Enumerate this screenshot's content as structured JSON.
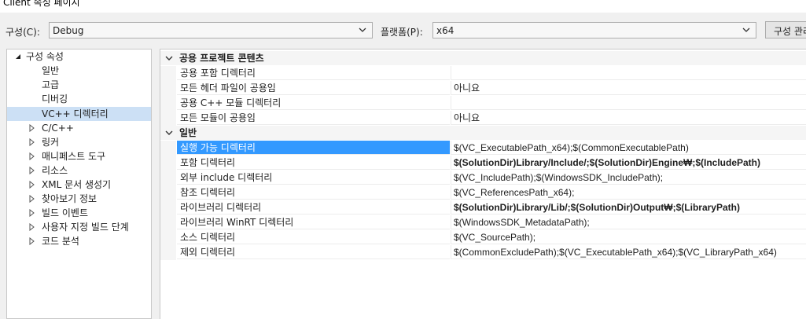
{
  "window": {
    "title": "Client 속성 페이지"
  },
  "toolbar": {
    "config_label": "구성(C):",
    "config_value": "Debug",
    "platform_label": "플랫폼(P):",
    "platform_value": "x64",
    "config_manager_label": "구성 관리자"
  },
  "tree": {
    "root": "구성 속성",
    "items": [
      {
        "label": "일반"
      },
      {
        "label": "고급"
      },
      {
        "label": "디버깅"
      },
      {
        "label": "VC++ 디렉터리"
      },
      {
        "label": "C/C++"
      },
      {
        "label": "링커"
      },
      {
        "label": "매니페스트 도구"
      },
      {
        "label": "리소스"
      },
      {
        "label": "XML 문서 생성기"
      },
      {
        "label": "찾아보기 정보"
      },
      {
        "label": "빌드 이벤트"
      },
      {
        "label": "사용자 지정 빌드 단계"
      },
      {
        "label": "코드 분석"
      }
    ]
  },
  "grid": {
    "categories": [
      {
        "title": "공용 프로젝트 콘텐츠",
        "rows": [
          {
            "name": "공용 포함 디렉터리",
            "value": ""
          },
          {
            "name": "모든 헤더 파일이 공용임",
            "value": "아니요"
          },
          {
            "name": "공용 C++ 모듈 디렉터리",
            "value": ""
          },
          {
            "name": "모든 모듈이 공용임",
            "value": "아니요"
          }
        ]
      },
      {
        "title": "일반",
        "rows": [
          {
            "name": "실행 가능 디렉터리",
            "value": "$(VC_ExecutablePath_x64);$(CommonExecutablePath)"
          },
          {
            "name": "포함 디렉터리",
            "value": "$(SolutionDir)Library/Include/;$(SolutionDir)Engine₩;$(IncludePath)"
          },
          {
            "name": "외부 include 디렉터리",
            "value": "$(VC_IncludePath);$(WindowsSDK_IncludePath);"
          },
          {
            "name": "참조 디렉터리",
            "value": "$(VC_ReferencesPath_x64);"
          },
          {
            "name": "라이브러리 디렉터리",
            "value": "$(SolutionDir)Library/Lib/;$(SolutionDir)Output₩;$(LibraryPath)"
          },
          {
            "name": "라이브러리 WinRT 디렉터리",
            "value": "$(WindowsSDK_MetadataPath);"
          },
          {
            "name": "소스 디렉터리",
            "value": "$(VC_SourcePath);"
          },
          {
            "name": "제외 디렉터리",
            "value": "$(CommonExcludePath);$(VC_ExecutablePath_x64);$(VC_LibraryPath_x64)"
          }
        ]
      }
    ]
  }
}
